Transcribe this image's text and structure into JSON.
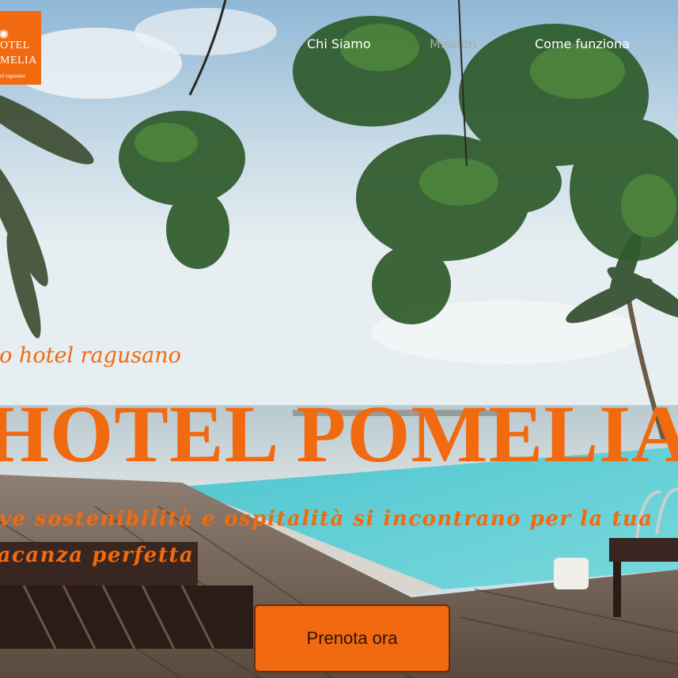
{
  "brand": {
    "logo_line1": "OTEL",
    "logo_line2": "MELIA",
    "logo_line3": "el ragusano",
    "accent_color": "#f26a10",
    "logo_icon": "sun-flower-icon"
  },
  "nav": {
    "items": [
      {
        "label": "Chi Siamo"
      },
      {
        "label": "Mission"
      },
      {
        "label": "Come funziona"
      }
    ]
  },
  "hero": {
    "tagline": "co hotel ragusano",
    "title": "HOTEL POMELIA",
    "subtitle": "ove sostenibilità e ospitalità si incontrano per la tua vacanza perfetta",
    "cta_label": "Prenota ora"
  }
}
